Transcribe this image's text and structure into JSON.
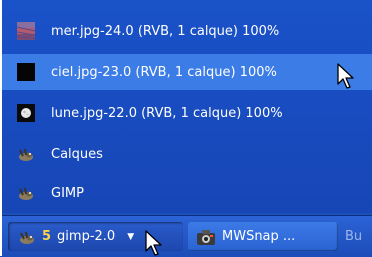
{
  "menu": {
    "items": [
      {
        "label": "mer.jpg-24.0 (RVB, 1 calque) 100%",
        "icon": "sea-image-thumbnail-icon"
      },
      {
        "label": "ciel.jpg-23.0 (RVB, 1 calque) 100%",
        "icon": "sky-image-thumbnail-icon"
      },
      {
        "label": "lune.jpg-22.0 (RVB, 1 calque) 100%",
        "icon": "moon-image-thumbnail-icon"
      },
      {
        "label": "Calques",
        "icon": "gimp-wilber-icon"
      },
      {
        "label": "GIMP",
        "icon": "gimp-wilber-icon"
      }
    ]
  },
  "taskbar": {
    "gimp_group": {
      "count": "5",
      "label": "gimp-2.0"
    },
    "mwsnap": {
      "label": "MWSnap ..."
    },
    "partial": {
      "label": "Bu"
    }
  },
  "colors": {
    "menu_bg": "#1a52c9",
    "highlight": "#3c7ce6",
    "count_accent": "#ffd24a"
  }
}
